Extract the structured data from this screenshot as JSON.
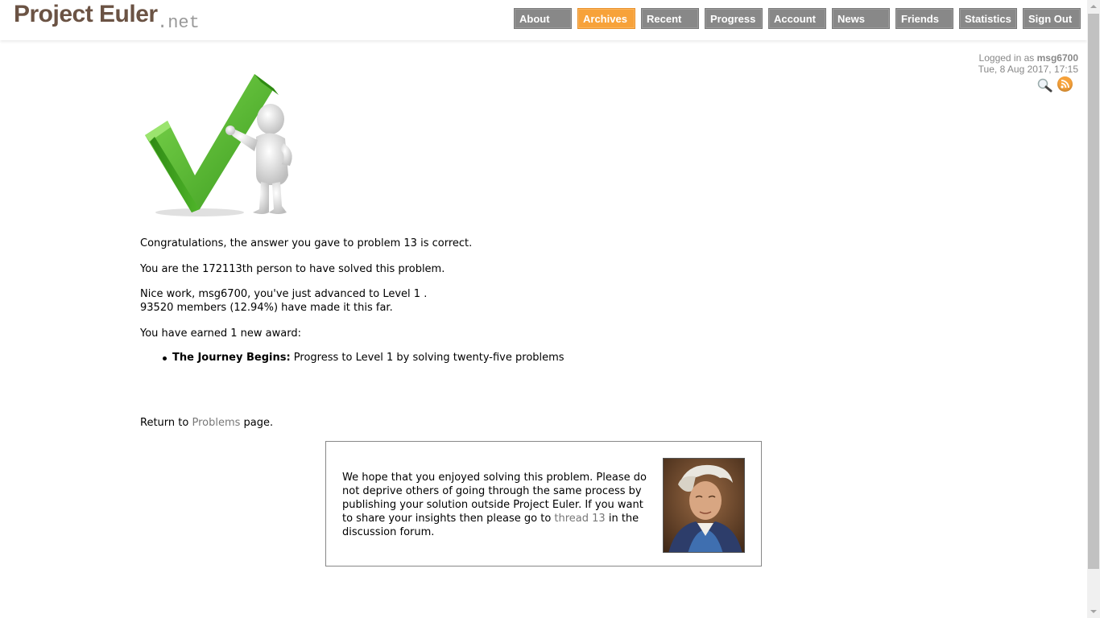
{
  "header": {
    "logo_main": "Project Euler",
    "logo_net": ".net",
    "nav": [
      "About",
      "Archives",
      "Recent",
      "Progress",
      "Account",
      "News",
      "Friends",
      "Statistics",
      "Sign Out"
    ],
    "active_nav": "Archives"
  },
  "user_info": {
    "logged_in_prefix": "Logged in as",
    "username": "msg6700",
    "datetime": "Tue, 8 Aug 2017, 17:15",
    "icons": [
      "search-icon",
      "rss-icon"
    ]
  },
  "content": {
    "congrats": "Congratulations, the answer you gave to problem 13 is correct.",
    "solver_rank": "You are the 172113th person to have solved this problem.",
    "level_line1": "Nice work, msg6700, you've just advanced to Level 1 .",
    "level_line2": "93520 members (12.94%) have made it this far.",
    "award_intro": "You have earned 1 new award:",
    "award_title": "The Journey Begins:",
    "award_desc": " Progress to Level 1 by solving twenty-five problems",
    "return_prefix": "Return to ",
    "return_link": "Problems",
    "return_suffix": " page."
  },
  "forum_box": {
    "text_before_link": "We hope that you enjoyed solving this problem. Please do not deprive others of going through the same process by publishing your solution outside Project Euler. If you want to share your insights then please go to ",
    "link_text": "thread 13",
    "text_after_link": " in the discussion forum."
  },
  "colors": {
    "logo": "#6b5344",
    "nav_bg": "#888888",
    "nav_active": "#f7a23a",
    "link": "#777777",
    "check_green": "#5cc13a"
  }
}
